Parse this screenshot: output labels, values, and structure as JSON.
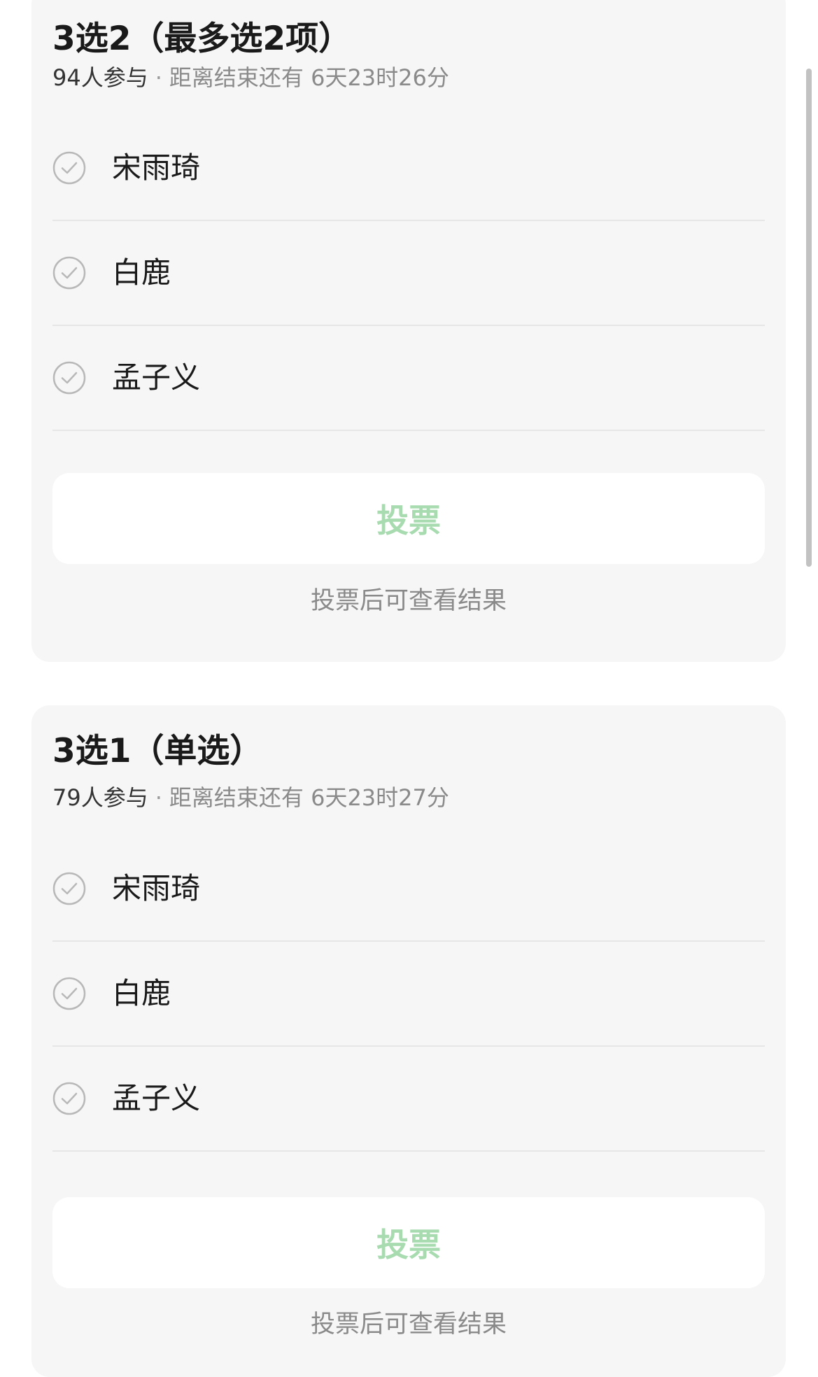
{
  "polls": [
    {
      "title": "3选2（最多选2项）",
      "participants": "94人参与",
      "separator": "·",
      "deadline": "距离结束还有 6天23时26分",
      "options": [
        {
          "label": "宋雨琦"
        },
        {
          "label": "白鹿"
        },
        {
          "label": "孟子义"
        }
      ],
      "vote_button": "投票",
      "result_hint": "投票后可查看结果"
    },
    {
      "title": "3选1（单选）",
      "participants": "79人参与",
      "separator": "·",
      "deadline": "距离结束还有 6天23时27分",
      "options": [
        {
          "label": "宋雨琦"
        },
        {
          "label": "白鹿"
        },
        {
          "label": "孟子义"
        }
      ],
      "vote_button": "投票",
      "result_hint": "投票后可查看结果"
    }
  ],
  "colors": {
    "card_background": "#f6f6f6",
    "vote_button_text_disabled": "#a8dcb0",
    "title_text": "#1a1a1a",
    "meta_text": "#8a8a8a",
    "check_icon": "#b8b8b8"
  },
  "icons": {
    "option_check": "check-circle-icon"
  }
}
